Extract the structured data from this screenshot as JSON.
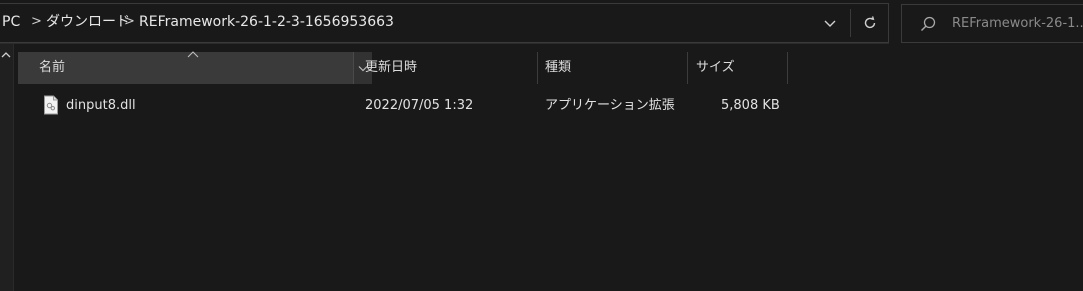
{
  "address": {
    "crumbs": [
      "PC",
      "ダウンロード",
      "REFramework-26-1-2-3-1656953663"
    ],
    "separator": ">"
  },
  "search": {
    "placeholder": "REFramework-26-1..."
  },
  "columns": {
    "name": "名前",
    "modified": "更新日時",
    "type": "種類",
    "size": "サイズ"
  },
  "files": [
    {
      "name": "dinput8.dll",
      "modified": "2022/07/05 1:32",
      "type": "アプリケーション拡張",
      "size": "5,808 KB",
      "icon": "dll-file-icon"
    }
  ],
  "icons": {
    "dropdown": "chevron-down-icon",
    "refresh": "refresh-icon",
    "search": "search-icon",
    "sort": "sort-ascending-icon",
    "scroll": "scroll-up-icon"
  },
  "colors": {
    "background": "#191919",
    "text": "#e6e6e6",
    "header_selected": "#3a3a3a",
    "border": "#3a3a3a"
  }
}
